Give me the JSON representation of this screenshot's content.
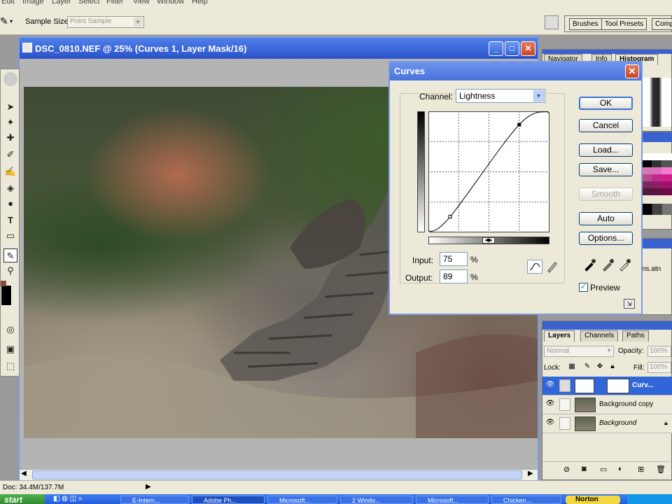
{
  "menubar": {
    "items": [
      "Edit",
      "Image",
      "Layer",
      "Select",
      "Filter",
      "View",
      "Window",
      "Help"
    ]
  },
  "options": {
    "sample_size_label": "Sample Size:",
    "sample_size_value": "Point Sample"
  },
  "palette_well": {
    "tabs": [
      "Brushes",
      "Tool Presets",
      "Comp"
    ]
  },
  "document": {
    "title": "DSC_0810.NEF @ 25% (Curves 1, Layer Mask/16)"
  },
  "navigator": {
    "tabs": [
      "Navigator",
      "Info",
      "Histogram"
    ]
  },
  "styles_panel": {
    "snippet": "ns.atn"
  },
  "layers": {
    "tabs": [
      "Layers",
      "Channels",
      "Paths"
    ],
    "blend_mode": "Normal",
    "opacity_label": "Opacity:",
    "opacity_value": "100%",
    "lock_label": "Lock:",
    "fill_label": "Fill:",
    "fill_value": "100%",
    "rows": [
      {
        "name": "Curv..."
      },
      {
        "name": "Background copy"
      },
      {
        "name": "Background"
      }
    ]
  },
  "status": {
    "doc_size": "Doc: 34.4M/137.7M"
  },
  "taskbar": {
    "start": "start",
    "tasks": [
      "E-Intern...",
      "Adobe Ph...",
      "Microsoft...",
      "2 Windo...",
      "Microsoft...",
      "Chicken..."
    ],
    "norton": "Norton"
  },
  "curves": {
    "title": "Curves",
    "channel_label": "Channel:",
    "channel_value": "Lightness",
    "input_label": "Input:",
    "input_value": "75",
    "output_label": "Output:",
    "output_value": "89",
    "percent": "%",
    "buttons": {
      "ok": "OK",
      "cancel": "Cancel",
      "load": "Load...",
      "save": "Save...",
      "smooth": "Smooth",
      "auto": "Auto",
      "options": "Options..."
    },
    "preview_label": "Preview",
    "preview_checked": true,
    "curve_points": [
      [
        0,
        0
      ],
      [
        18,
        13
      ],
      [
        75,
        89
      ],
      [
        100,
        100
      ]
    ]
  }
}
